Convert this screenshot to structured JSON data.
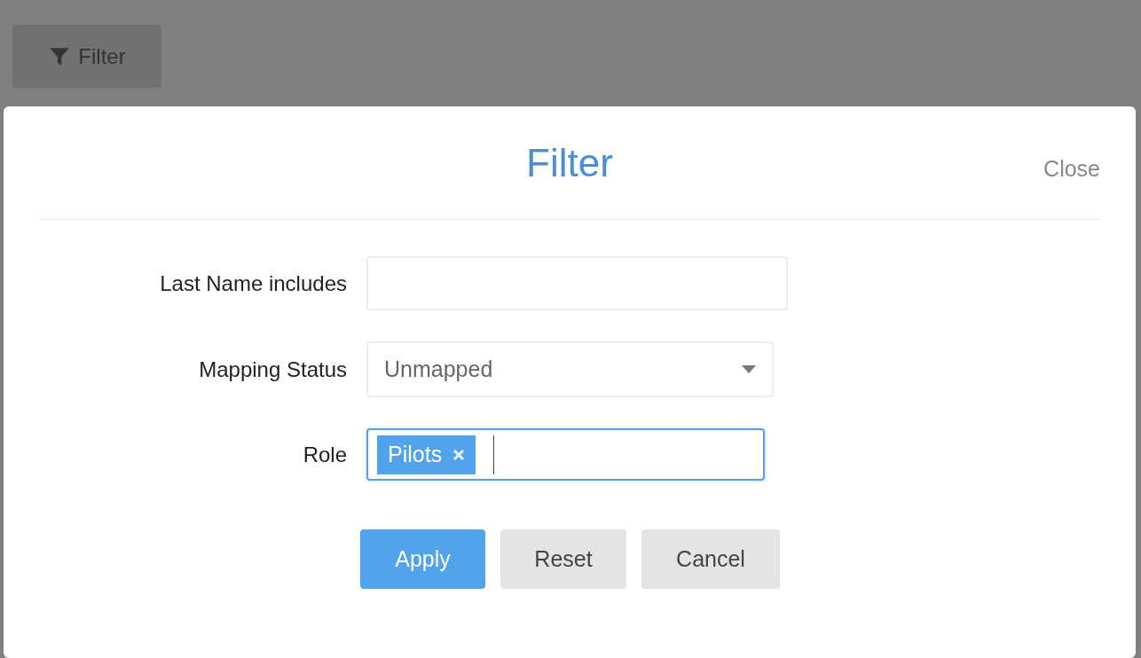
{
  "toolbar": {
    "filter_button": "Filter"
  },
  "dialog": {
    "title": "Filter",
    "close": "Close",
    "fields": [
      {
        "kind": "text",
        "label": "Last Name includes",
        "focused": false
      },
      {
        "kind": "select",
        "label": "Mapping Status",
        "value": "Unmapped",
        "focused": false
      },
      {
        "kind": "tags",
        "label": "Role",
        "tags": [
          "Pilots"
        ],
        "focused": true
      }
    ],
    "buttons": [
      {
        "label": "Apply",
        "kind": "primary"
      },
      {
        "label": "Reset",
        "kind": "secondary"
      },
      {
        "label": "Cancel",
        "kind": "secondary"
      }
    ]
  }
}
